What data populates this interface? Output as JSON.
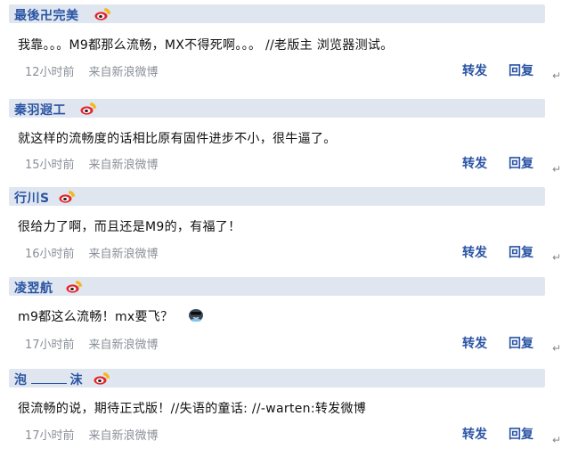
{
  "comments": [
    {
      "author": "最後卍完美",
      "text": "我靠。。。M9都那么流畅，MX不得死啊。。。 //老版主 浏览器测试。",
      "time": "12小时前",
      "source": "来自新浪微博",
      "forward_label": "转发",
      "reply_label": "回复"
    },
    {
      "author": "秦羽遐工",
      "text": "就这样的流畅度的话相比原有固件进步不小，很牛逼了。",
      "time": "15小时前",
      "source": "来自新浪微博",
      "forward_label": "转发",
      "reply_label": "回复"
    },
    {
      "author": "行川S",
      "text": "很给力了啊，而且还是M9的，有福了！",
      "time": "16小时前",
      "source": "来自新浪微博",
      "forward_label": "转发",
      "reply_label": "回复"
    },
    {
      "author": "凌翌航",
      "text": "m9都这么流畅！mx要飞？",
      "time": "17小时前",
      "source": "来自新浪微博",
      "forward_label": "转发",
      "reply_label": "回复"
    },
    {
      "author_part1": "泡",
      "author_part2": "沫",
      "text": "很流畅的说，期待正式版！//失语的童话: //-warten:转发微博",
      "time": "17小时前",
      "source": "来自新浪微博",
      "forward_label": "转发",
      "reply_label": "回复"
    }
  ],
  "icons": {
    "weibo": "weibo-icon",
    "emoji": "cool-face-emoji",
    "return": "return-arrow-icon"
  },
  "colors": {
    "header_bg": "#dfe6ef",
    "author": "#2a54a4",
    "meta": "#8a8f97",
    "weibo_red": "#e5262d",
    "weibo_yellow": "#f5b400"
  }
}
